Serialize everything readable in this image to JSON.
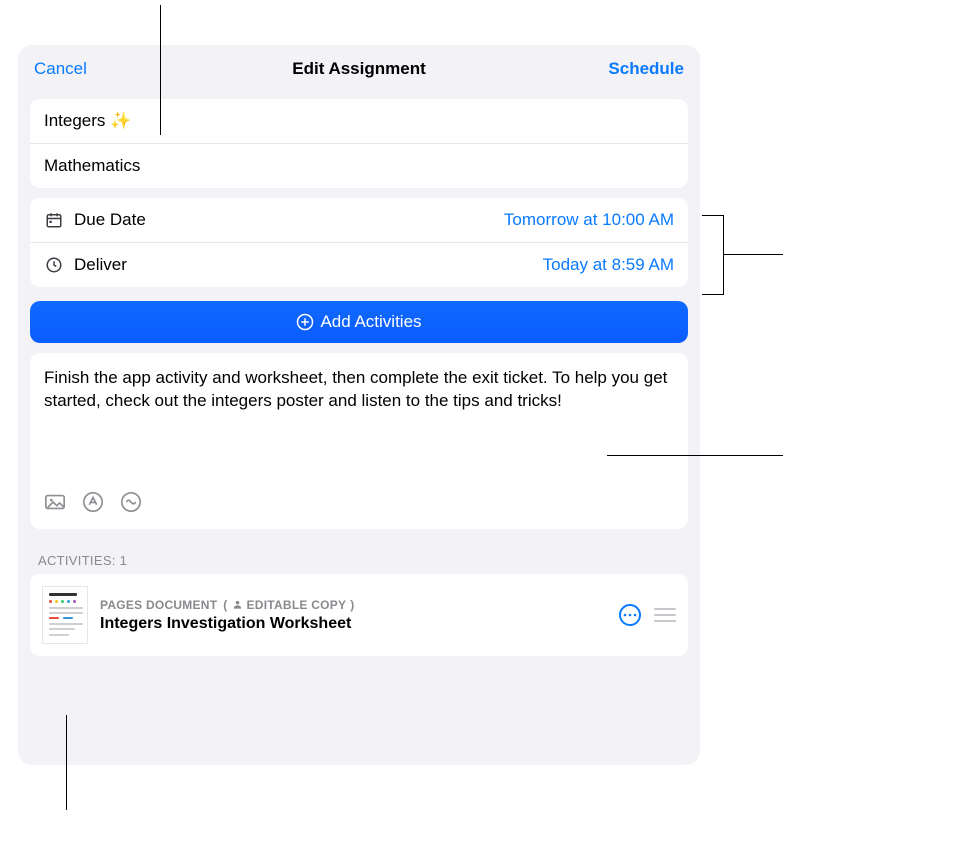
{
  "header": {
    "cancel": "Cancel",
    "title": "Edit Assignment",
    "schedule": "Schedule"
  },
  "assignment": {
    "name": "Integers ✨",
    "class": "Mathematics"
  },
  "dates": {
    "due": {
      "label": "Due Date",
      "value": "Tomorrow at 10:00 AM"
    },
    "deliver": {
      "label": "Deliver",
      "value": "Today at 8:59 AM"
    }
  },
  "add_activities_label": "Add Activities",
  "instructions": "Finish the app activity and worksheet, then complete the exit ticket. To help you get started, check out the integers poster and listen to the tips and tricks!",
  "activities_header": "ACTIVITIES: 1",
  "activity": {
    "type_label": "PAGES DOCUMENT",
    "share_mode": "EDITABLE COPY",
    "title": "Integers Investigation Worksheet"
  },
  "icons": {
    "due": "calendar-icon",
    "deliver": "clock-icon",
    "plus": "plus-circle-icon",
    "photo": "photo-icon",
    "drawing": "drawing-icon",
    "audio": "audio-icon",
    "person": "person-icon",
    "more": "more-circle-icon",
    "drag": "drag-handle-icon"
  }
}
